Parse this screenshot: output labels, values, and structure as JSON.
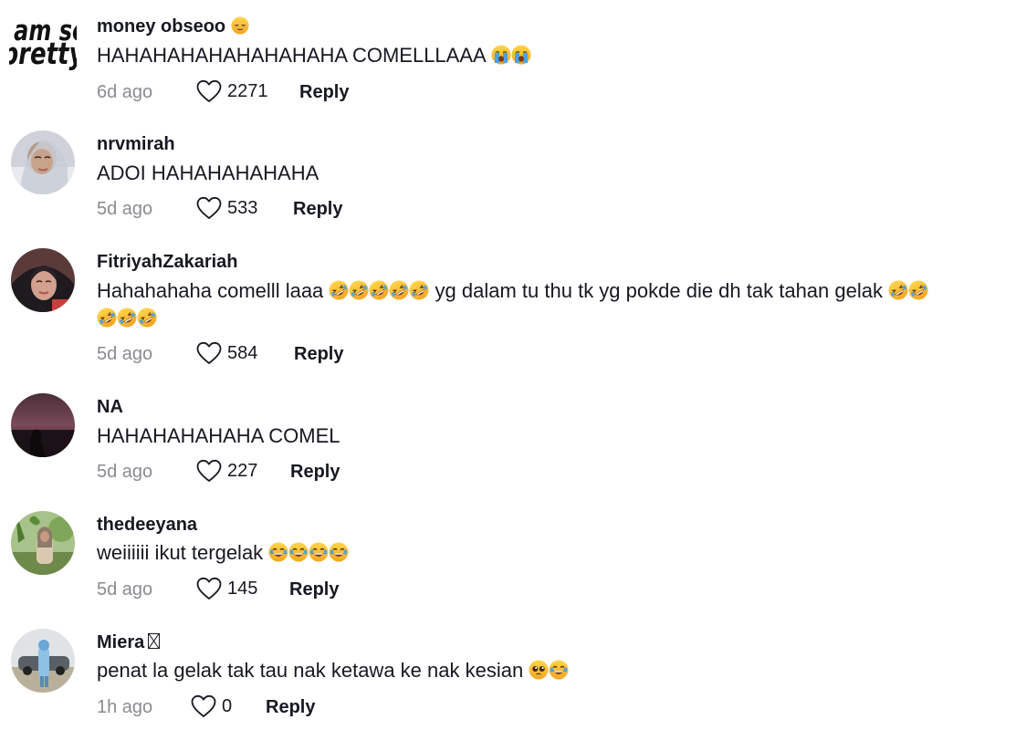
{
  "comments": [
    {
      "username": "money obseoo",
      "username_emoji": "relieved-face",
      "text": "HAHAHAHAHAHAHAHAHA COMELLLAAA",
      "text_emojis": [
        "loudly-crying-face",
        "loudly-crying-face"
      ],
      "time": "6d ago",
      "likes": "2271",
      "reply": "Reply",
      "avatar_text": [
        "i am so",
        "pretty"
      ]
    },
    {
      "username": "nrvmirah",
      "text": "ADOI HAHAHAHAHAHA",
      "time": "5d ago",
      "likes": "533",
      "reply": "Reply"
    },
    {
      "username": "FitriyahZakariah",
      "text_part1": "Hahahahaha comelll laaa",
      "text_emojis_1": [
        "rofl",
        "rofl",
        "rofl",
        "rofl",
        "rofl"
      ],
      "text_part2": "yg dalam tu thu tk yg pokde die dh tak tahan gelak",
      "text_emojis_2": [
        "rofl",
        "rofl",
        "rofl",
        "rofl",
        "rofl"
      ],
      "time": "5d ago",
      "likes": "584",
      "reply": "Reply"
    },
    {
      "username": "NA",
      "text": "HAHAHAHAHAHA COMEL",
      "time": "5d ago",
      "likes": "227",
      "reply": "Reply"
    },
    {
      "username": "thedeeyana",
      "text": "weiiiiii ikut tergelak",
      "text_emojis": [
        "tears-of-joy",
        "tears-of-joy",
        "tears-of-joy",
        "tears-of-joy"
      ],
      "time": "5d ago",
      "likes": "145",
      "reply": "Reply"
    },
    {
      "username": "Miera",
      "username_glyph": "missing-glyph-box",
      "text": "penat la gelak tak tau nak ketawa ke nak kesian",
      "text_emojis": [
        "pleading-face",
        "tears-of-joy"
      ],
      "time": "1h ago",
      "likes": "0",
      "reply": "Reply"
    }
  ],
  "icons": {
    "like": "heart-outline-icon"
  },
  "colors": {
    "text": "#161823",
    "meta": "#8a8b91",
    "background": "#ffffff"
  }
}
